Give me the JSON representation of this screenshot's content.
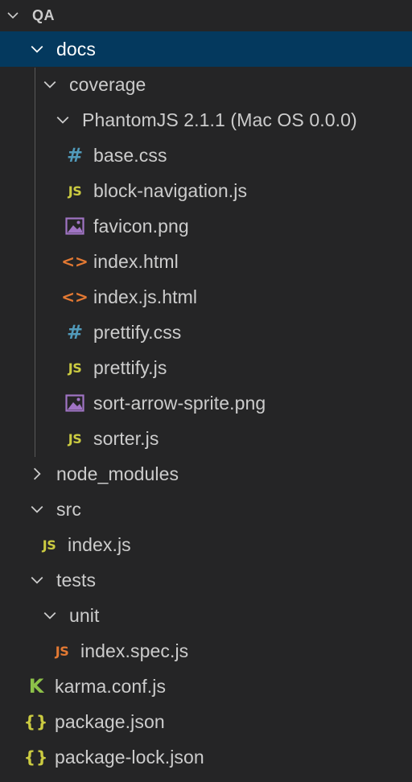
{
  "explorer": {
    "root": {
      "label": "QA",
      "expanded": true
    },
    "items": [
      {
        "label": "docs",
        "type": "folder",
        "expanded": true,
        "depth": 1,
        "selected": true
      },
      {
        "label": "coverage",
        "type": "folder",
        "expanded": true,
        "depth": 2
      },
      {
        "label": "PhantomJS 2.1.1 (Mac OS 0.0.0)",
        "type": "folder",
        "expanded": true,
        "depth": 3
      },
      {
        "label": "base.css",
        "type": "file",
        "icon": "css-hash-icon",
        "depth": 4
      },
      {
        "label": "block-navigation.js",
        "type": "file",
        "icon": "js-icon",
        "depth": 4
      },
      {
        "label": "favicon.png",
        "type": "file",
        "icon": "image-icon",
        "depth": 4
      },
      {
        "label": "index.html",
        "type": "file",
        "icon": "html-icon",
        "depth": 4
      },
      {
        "label": "index.js.html",
        "type": "file",
        "icon": "html-icon",
        "depth": 4
      },
      {
        "label": "prettify.css",
        "type": "file",
        "icon": "css-hash-icon",
        "depth": 4
      },
      {
        "label": "prettify.js",
        "type": "file",
        "icon": "js-icon",
        "depth": 4
      },
      {
        "label": "sort-arrow-sprite.png",
        "type": "file",
        "icon": "image-icon",
        "depth": 4
      },
      {
        "label": "sorter.js",
        "type": "file",
        "icon": "js-icon",
        "depth": 4
      },
      {
        "label": "node_modules",
        "type": "folder",
        "expanded": false,
        "depth": 1
      },
      {
        "label": "src",
        "type": "folder",
        "expanded": true,
        "depth": 1
      },
      {
        "label": "index.js",
        "type": "file",
        "icon": "js-icon",
        "depth": 2
      },
      {
        "label": "tests",
        "type": "folder",
        "expanded": true,
        "depth": 1
      },
      {
        "label": "unit",
        "type": "folder",
        "expanded": true,
        "depth": 2
      },
      {
        "label": "index.spec.js",
        "type": "file",
        "icon": "js-test-icon",
        "depth": 3
      },
      {
        "label": "karma.conf.js",
        "type": "file",
        "icon": "karma-icon",
        "depth": 1
      },
      {
        "label": "package.json",
        "type": "file",
        "icon": "json-icon",
        "depth": 1
      },
      {
        "label": "package-lock.json",
        "type": "file",
        "icon": "json-icon",
        "depth": 1
      }
    ]
  },
  "icon_glyphs": {
    "js": "JS",
    "css": "#",
    "html": "<>",
    "json": "{}",
    "karma": "K"
  },
  "colors": {
    "background": "#252526",
    "selection": "#04395e",
    "text": "#cccccc",
    "js": "#cbcb41",
    "css": "#519aba",
    "html": "#e37933",
    "image": "#a074c4",
    "karma": "#8dc149"
  }
}
